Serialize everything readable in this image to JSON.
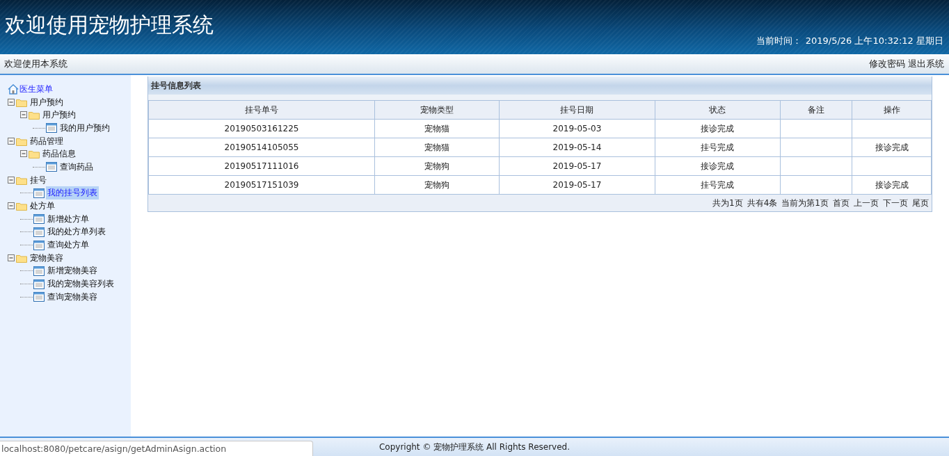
{
  "header": {
    "title": "欢迎使用宠物护理系统",
    "clock_label": "当前时间：",
    "clock_value": "2019/5/26 上午10:32:12 星期日"
  },
  "subbar": {
    "welcome": "欢迎使用本系统",
    "links": [
      "修改密码",
      "退出系统"
    ]
  },
  "sidebar": {
    "root": "医生菜单",
    "items": [
      {
        "label": "用户预约",
        "kind": "folder",
        "expanded": true,
        "selected": false,
        "children": [
          {
            "label": "用户预约",
            "kind": "folder",
            "expanded": true,
            "selected": false,
            "children": [
              {
                "label": "我的用户预约",
                "kind": "page",
                "selected": false
              }
            ]
          }
        ]
      },
      {
        "label": "药品管理",
        "kind": "folder",
        "expanded": true,
        "selected": false,
        "children": [
          {
            "label": "药品信息",
            "kind": "folder",
            "expanded": true,
            "selected": false,
            "children": [
              {
                "label": "查询药品",
                "kind": "page",
                "selected": false
              }
            ]
          }
        ]
      },
      {
        "label": "挂号",
        "kind": "folder",
        "expanded": true,
        "selected": false,
        "children": [
          {
            "label": "我的挂号列表",
            "kind": "page",
            "selected": true
          }
        ]
      },
      {
        "label": "处方单",
        "kind": "folder",
        "expanded": true,
        "selected": false,
        "children": [
          {
            "label": "新增处方单",
            "kind": "page",
            "selected": false
          },
          {
            "label": "我的处方单列表",
            "kind": "page",
            "selected": false
          },
          {
            "label": "查询处方单",
            "kind": "page",
            "selected": false
          }
        ]
      },
      {
        "label": "宠物美容",
        "kind": "folder",
        "expanded": true,
        "selected": false,
        "children": [
          {
            "label": "新增宠物美容",
            "kind": "page",
            "selected": false
          },
          {
            "label": "我的宠物美容列表",
            "kind": "page",
            "selected": false
          },
          {
            "label": "查询宠物美容",
            "kind": "page",
            "selected": false
          }
        ]
      }
    ]
  },
  "panel": {
    "title": "挂号信息列表",
    "table": {
      "columns": [
        "挂号单号",
        "宠物类型",
        "挂号日期",
        "状态",
        "备注",
        "操作"
      ],
      "rows": [
        [
          "20190503161225",
          "宠物猫",
          "2019-05-03",
          "接诊完成",
          "",
          ""
        ],
        [
          "20190514105055",
          "宠物猫",
          "2019-05-14",
          "挂号完成",
          "",
          "接诊完成"
        ],
        [
          "20190517111016",
          "宠物狗",
          "2019-05-17",
          "接诊完成",
          "",
          ""
        ],
        [
          "20190517151039",
          "宠物狗",
          "2019-05-17",
          "挂号完成",
          "",
          "接诊完成"
        ]
      ]
    },
    "pager_info": [
      "共为1页",
      "共有4条",
      "当前为第1页"
    ],
    "pager_links": [
      "首页",
      "上一页",
      "下一页",
      "尾页"
    ]
  },
  "footer": {
    "copyright": "Copyright © 宠物护理系统 All Rights Reserved.",
    "status_url": "localhost:8080/petcare/asign/getAdminAsign.action"
  }
}
